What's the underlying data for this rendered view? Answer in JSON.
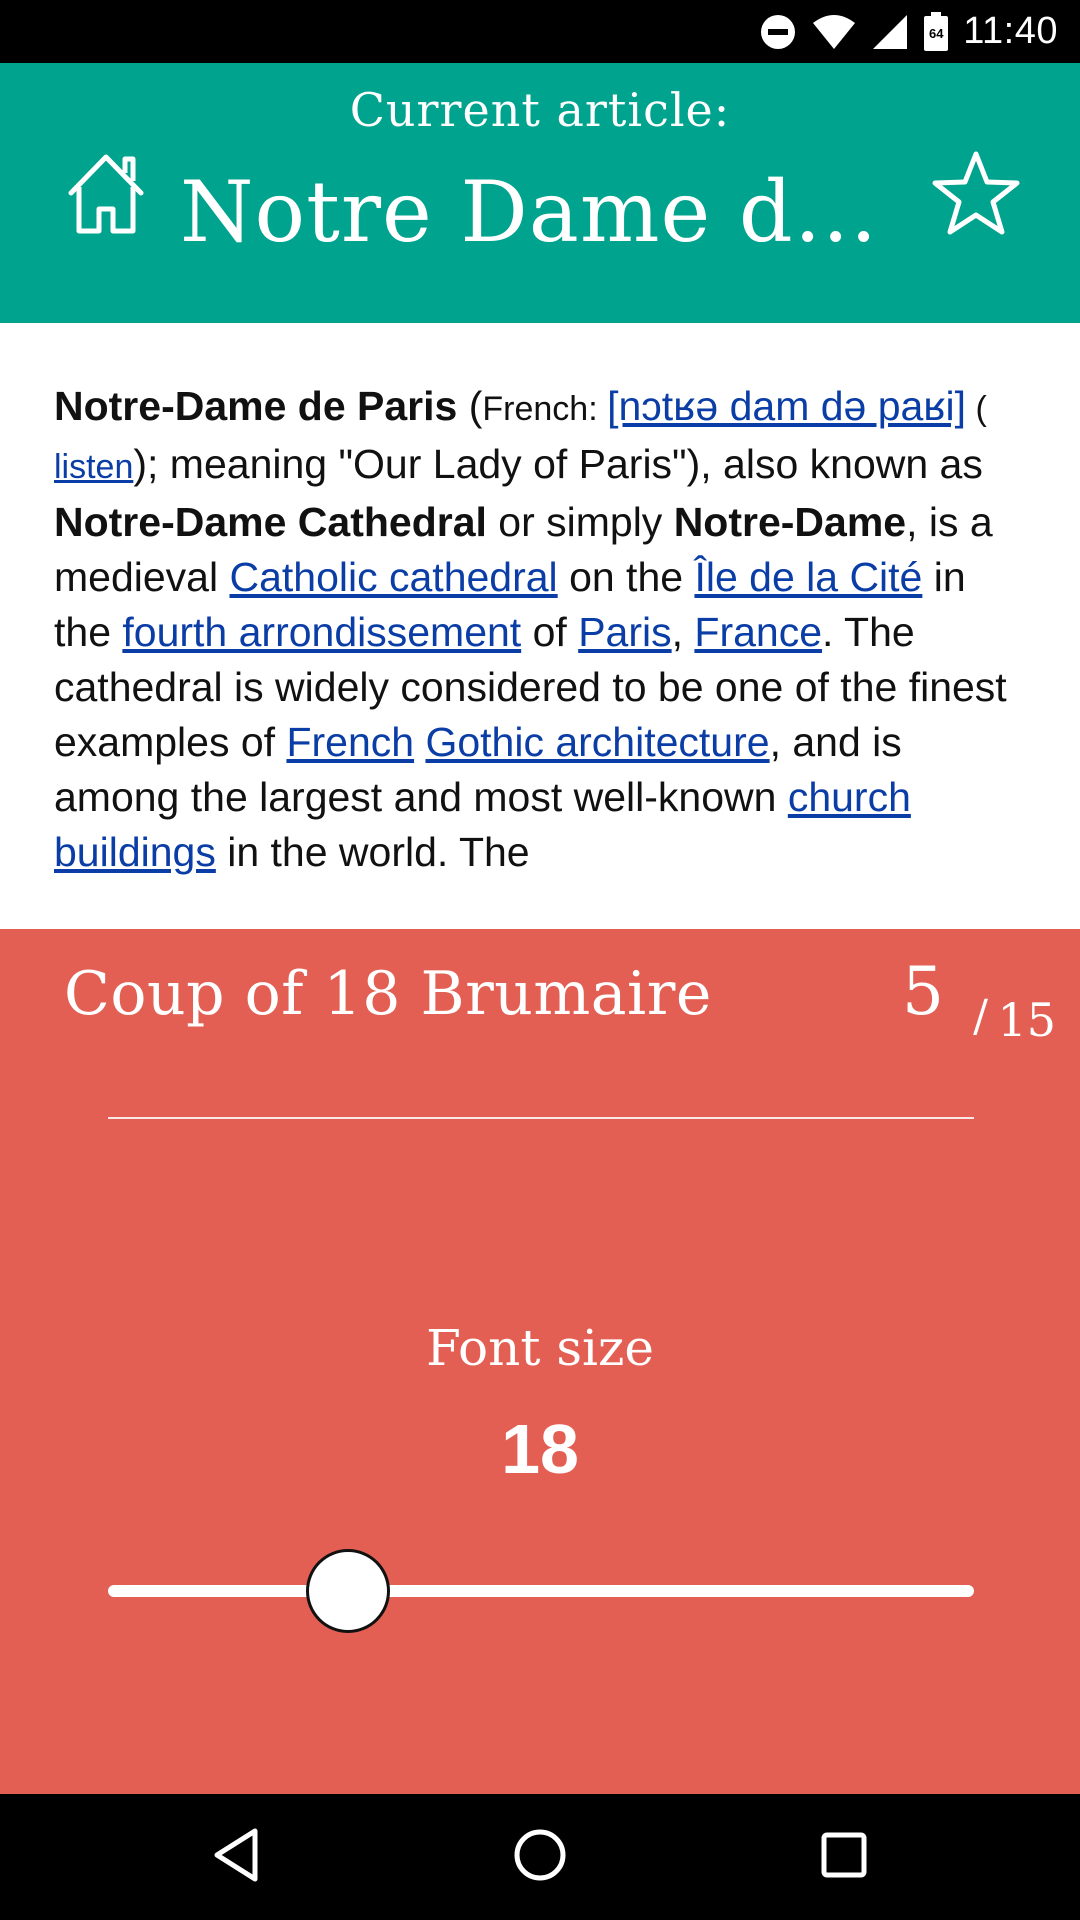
{
  "status_bar": {
    "time": "11:40",
    "icons": [
      "do-not-disturb-icon",
      "wifi-icon",
      "cell-signal-icon",
      "battery-icon"
    ],
    "battery_label": "64"
  },
  "header": {
    "subtitle": "Current article:",
    "title": "Notre Dame de Paris",
    "home_icon": "home-icon",
    "favorite_icon": "star-icon",
    "background": "#00a38d"
  },
  "article": {
    "title_bold": "Notre-Dame de Paris",
    "paren_open": "(",
    "french_label": "French: ",
    "ipa_link": "[nɔtʁə dam də paʁi]",
    "listen_open": " ( ",
    "listen_link": "listen",
    "meaning": "); meaning \"Our Lady of Paris\"), also known as ",
    "alt_name_1": "Notre-Dame Cathedral",
    "or_text": " or simply ",
    "alt_name_2": "Notre-Dame",
    "is_medieval": ", is a medieval ",
    "link_catholic": "Catholic cathedral",
    "on_the": " on the ",
    "link_ile": "Île de la Cité",
    "in_the": " in the ",
    "link_fourth": "fourth arrondissement",
    "of_text": " of ",
    "link_paris": "Paris",
    "comma": ", ",
    "link_france": "France",
    "sentence_2": ". The cathedral is widely considered to be one of the finest examples of ",
    "link_french": "French",
    "space": " ",
    "link_gothic": "Gothic architecture",
    "sentence_3": ", and is among the largest and most well-known ",
    "link_church": "church buildings",
    "sentence_end": " in the world. The"
  },
  "panel": {
    "background": "#e35f53",
    "next_article": "Coup of 18 Brumaire",
    "current_index": "5",
    "separator": "/",
    "total": "15",
    "font_size_label": "Font size",
    "font_size_value": "18",
    "slider_fraction": 0.277
  },
  "nav_bar": {
    "icons": [
      "back-icon",
      "home-circle-icon",
      "recents-icon"
    ]
  }
}
